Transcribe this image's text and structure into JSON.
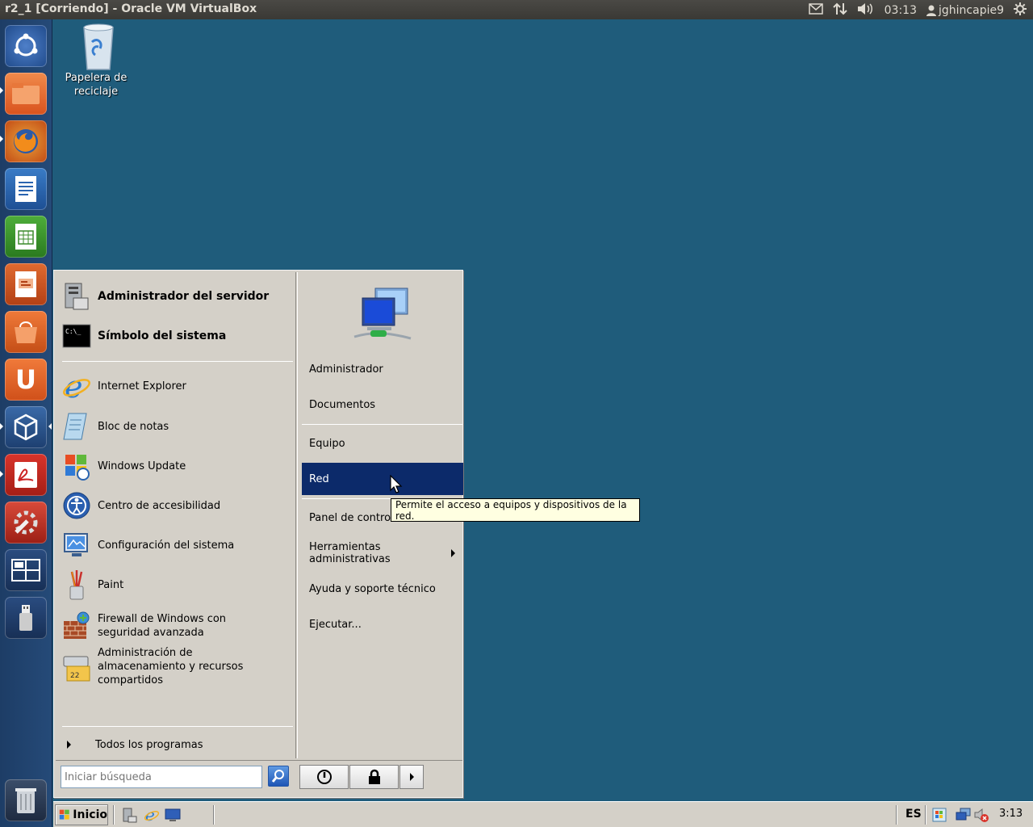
{
  "top_panel": {
    "window_title": "r2_1 [Corriendo] - Oracle VM VirtualBox",
    "time": "03:13",
    "user": "jghincapie9"
  },
  "desktop": {
    "recycle_bin_label": "Papelera de reciclaje"
  },
  "start_menu": {
    "pinned": [
      {
        "label": "Administrador del servidor"
      },
      {
        "label": "Símbolo del sistema"
      }
    ],
    "recent": [
      {
        "label": "Internet Explorer"
      },
      {
        "label": "Bloc de notas"
      },
      {
        "label": "Windows Update"
      },
      {
        "label": "Centro de accesibilidad"
      },
      {
        "label": "Configuración del sistema"
      },
      {
        "label": "Paint"
      },
      {
        "label": "Firewall de Windows con seguridad avanzada"
      },
      {
        "label": "Administración de almacenamiento y recursos compartidos"
      }
    ],
    "all_programs": "Todos los programas",
    "search_placeholder": "Iniciar búsqueda",
    "right": {
      "user": "Administrador",
      "documents": "Documentos",
      "computer": "Equipo",
      "network": "Red",
      "control_panel": "Panel de control",
      "admin_tools": "Herramientas administrativas",
      "help": "Ayuda y soporte técnico",
      "run": "Ejecutar..."
    },
    "tooltip": "Permite el acceso a equipos y dispositivos de la red."
  },
  "taskbar": {
    "start_label": "Inicio",
    "language": "ES",
    "clock": "3:13"
  }
}
